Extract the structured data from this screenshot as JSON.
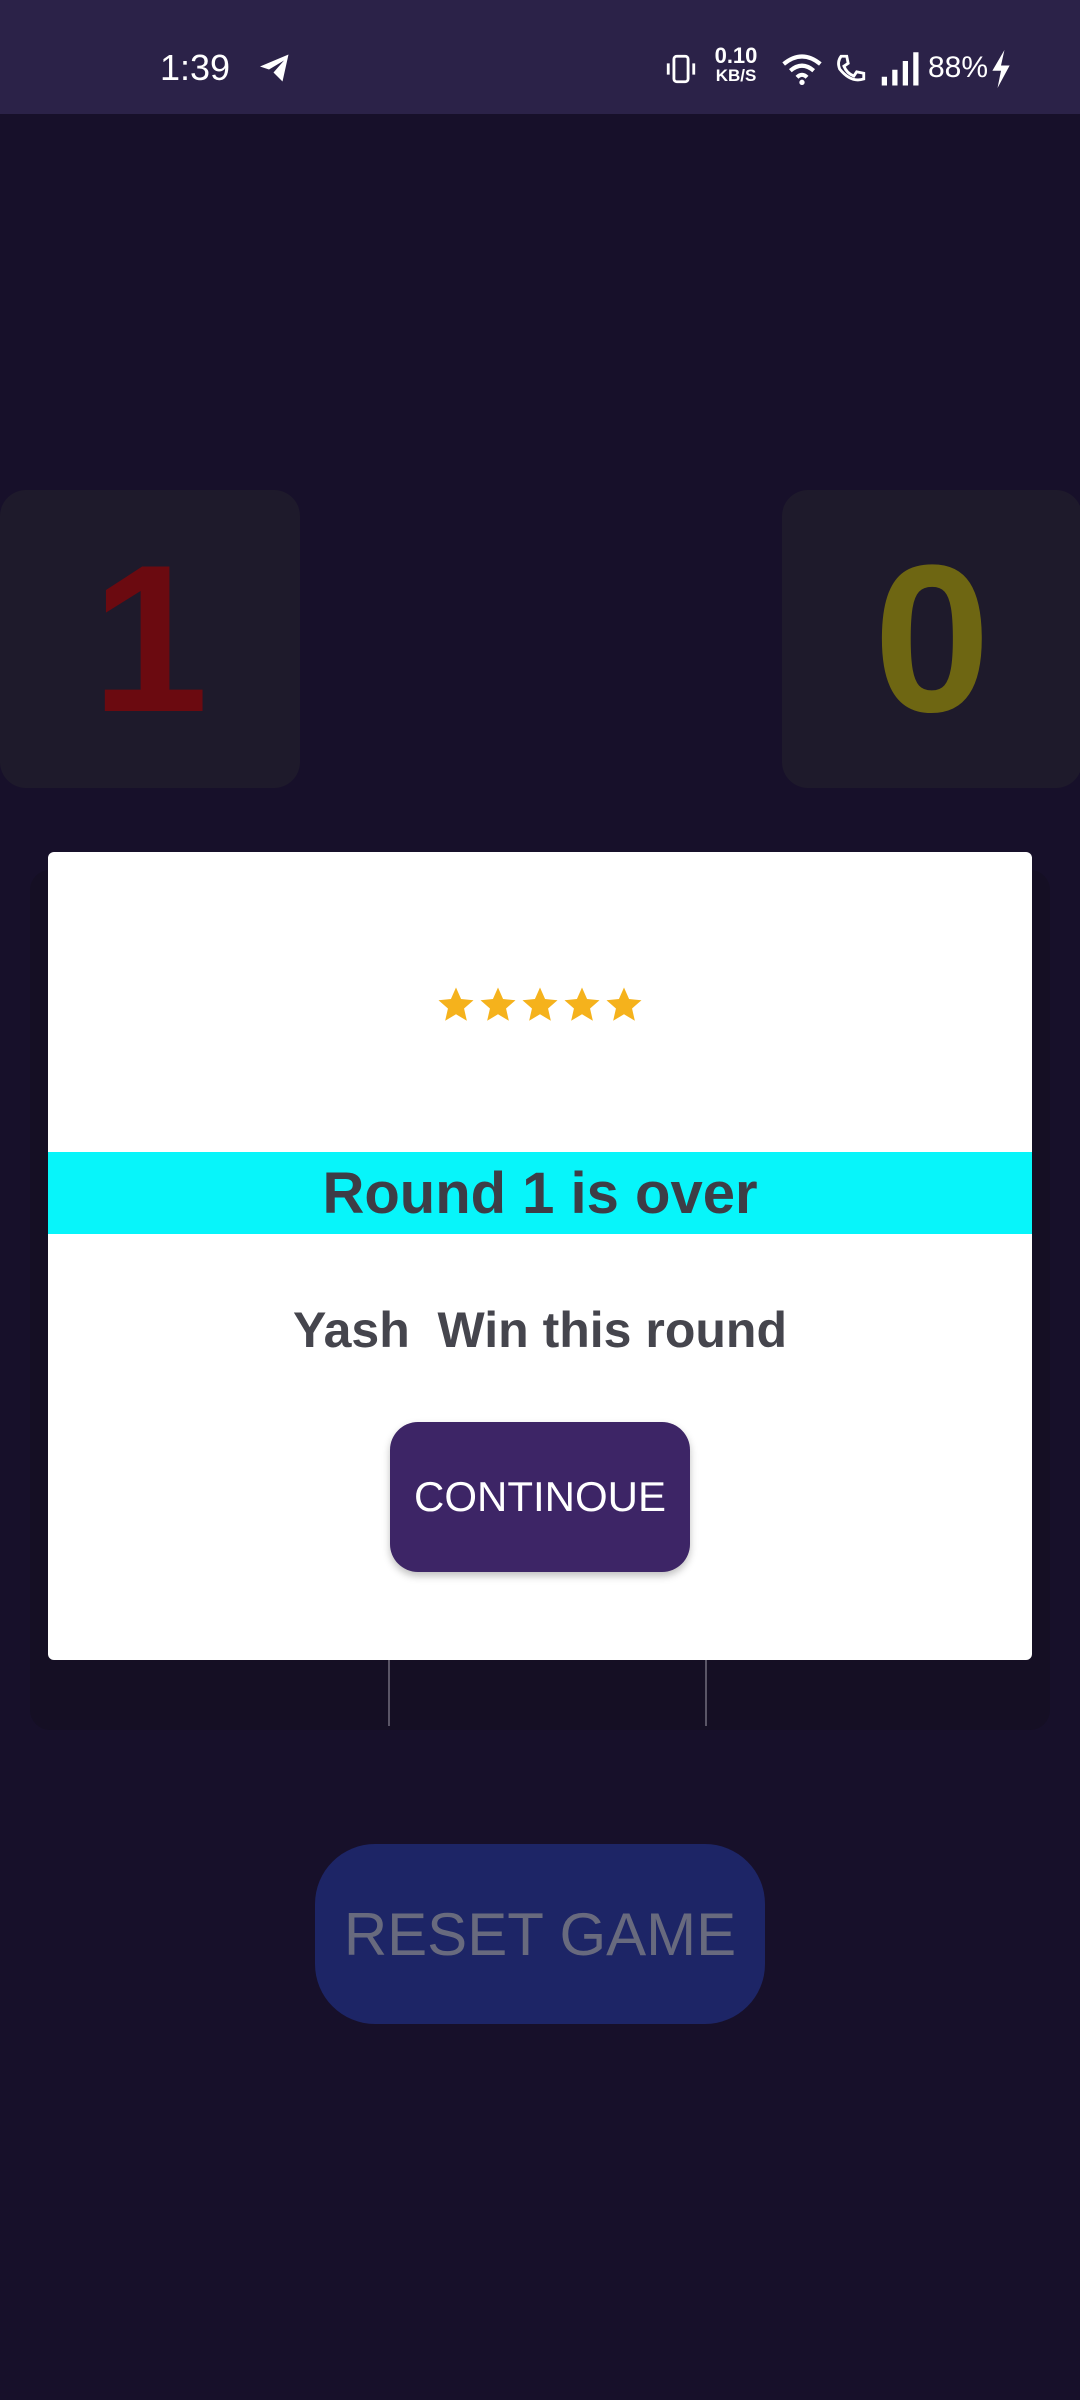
{
  "status_bar": {
    "time": "1:39",
    "net_speed_value": "0.10",
    "net_speed_unit": "KB/S",
    "battery": "88%",
    "icons": [
      "telegram-icon",
      "vibrate-icon",
      "wifi-icon",
      "wifi-call-icon",
      "signal-icon",
      "charging-icon"
    ]
  },
  "scores": {
    "left": "1",
    "right": "0"
  },
  "dialog": {
    "stars": 5,
    "title": "Round 1 is over",
    "message": "Yash  Win this round",
    "continue_label": "CONTINOUE"
  },
  "reset_label": "RESET GAME",
  "colors": {
    "background": "#17102a",
    "banner": "#07f5fa",
    "star": "#f5b21c",
    "continue_button": "#3d2566",
    "reset_button": "#1d2566",
    "left_score": "#6b0a10",
    "right_score": "#6e6612"
  }
}
